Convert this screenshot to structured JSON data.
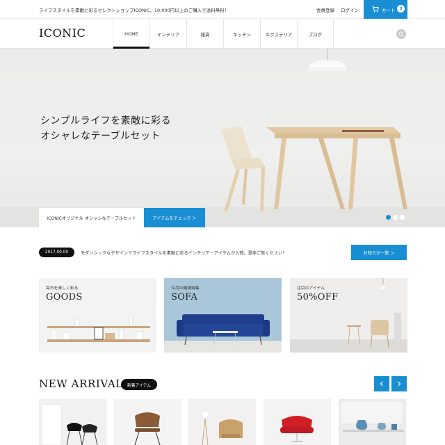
{
  "topbar": {
    "notice": "ライフスタイルを素敵に彩るセレクトショップICONIC。10,000円以上のご購入で送料無料！",
    "register": "会員登録",
    "login": "ログイン",
    "cart_label": "カート",
    "cart_count": "3"
  },
  "header": {
    "logo": "ICONIC",
    "nav": [
      "HOME",
      "インテリア",
      "雑貨",
      "キッチン",
      "エクステリア",
      "ブログ"
    ],
    "active_nav": "HOME"
  },
  "hero": {
    "headline_line1": "シンプルライフを素敵に彩る",
    "headline_line2": "オシャレなテーブルセット",
    "caption": "ICONICオリジナル オシャレなテーブルセット",
    "cta": "アイテムをチェック ＞",
    "slides": 3,
    "active_slide": 1
  },
  "news": {
    "date": "2017.00.00",
    "text": "モダンシックなデザインでライフスタイルを素敵に彩るインテリア・アイテムが入荷。是非ご覧ください！",
    "button": "お知らせ一覧 ＞"
  },
  "categories": [
    {
      "sub": "毎日を楽しく彩る",
      "title": "GOODS"
    },
    {
      "sub": "今月の厳選特集",
      "title": "SOFA"
    },
    {
      "sub": "注目のアイテム",
      "title": "50%OFF"
    }
  ],
  "new_arrival": {
    "title": "NEW ARRIVAL",
    "badge": "新着アイテム"
  },
  "colors": {
    "accent": "#1a8ed3",
    "dark": "#111111"
  }
}
